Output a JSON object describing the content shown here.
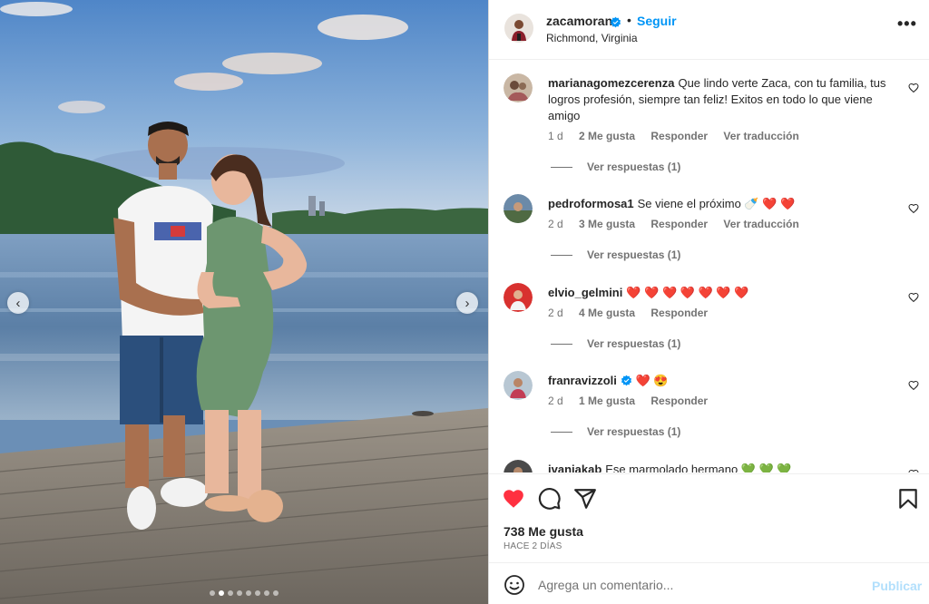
{
  "post": {
    "author": "zacamoran",
    "follow_label": "Seguir",
    "separator": "•",
    "location": "Richmond, Virginia",
    "more_label": "•••",
    "carousel": {
      "slides": 8,
      "active_index": 1
    }
  },
  "comments": [
    {
      "username": "marianagomezcerenza",
      "text": "Que lindo verte Zaca, con tu familia, tus logros profesión, siempre tan feliz! Exitos en todo lo que viene amigo",
      "time": "1 d",
      "likes": "2 Me gusta",
      "reply": "Responder",
      "translate": "Ver traducción",
      "view_replies": "Ver respuestas (1)"
    },
    {
      "username": "pedroformosa1",
      "text": "Se viene el próximo 🍼 ❤️ ❤️",
      "time": "2 d",
      "likes": "3 Me gusta",
      "reply": "Responder",
      "translate": "Ver traducción",
      "view_replies": "Ver respuestas (1)"
    },
    {
      "username": "elvio_gelmini",
      "text": "❤️ ❤️ ❤️ ❤️ ❤️ ❤️ ❤️",
      "time": "2 d",
      "likes": "4 Me gusta",
      "reply": "Responder",
      "view_replies": "Ver respuestas (1)"
    },
    {
      "username": "franravizzoli",
      "text": "❤️ 😍",
      "time": "2 d",
      "likes": "1 Me gusta",
      "reply": "Responder",
      "view_replies": "Ver respuestas (1)"
    },
    {
      "username": "ivaniakab",
      "text": "Ese marmolado hermano 💚 💚 💚"
    }
  ],
  "actions": {
    "likes_count": "738 Me gusta",
    "time_ago": "HACE 2 DÍAS",
    "like_active_color": "#ff3040"
  },
  "composer": {
    "placeholder": "Agrega un comentario...",
    "publish_label": "Publicar"
  },
  "icons": {
    "more": "more-options-icon",
    "like": "heart-icon",
    "comment": "comment-icon",
    "share": "share-icon",
    "save": "bookmark-icon",
    "emoji": "emoji-icon",
    "verified": "verified-badge-icon"
  },
  "colors": {
    "accent": "#0095f6",
    "secondary_text": "#737373",
    "publish_disabled": "#b2dffc"
  }
}
